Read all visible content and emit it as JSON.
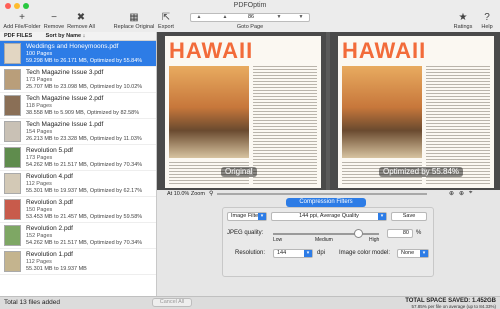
{
  "window": {
    "title": "PDFOptim",
    "traffic_colors": [
      "#ff5f57",
      "#febc2e",
      "#28c840"
    ]
  },
  "toolbar": {
    "add": "Add File/Folder",
    "remove": "Remove",
    "remove_all": "Remove All",
    "replace_original": "Replace Original",
    "export": "Export",
    "goto_page": "Goto Page",
    "page_value": "86",
    "ratings": "Ratings",
    "help": "Help"
  },
  "sidebar": {
    "header": "PDF FILES",
    "sort": "Sort by Name ↓",
    "items": [
      {
        "name": "Weddings and Honeymoons.pdf",
        "pages": "100 Pages",
        "stats": "59.298 MB to 26.171 MB, Optimized by 55.84%",
        "selected": true
      },
      {
        "name": "Tech Magazine Issue 3.pdf",
        "pages": "173 Pages",
        "stats": "25.707 MB to 23.098 MB, Optimized by 10.02%",
        "selected": false
      },
      {
        "name": "Tech Magazine Issue 2.pdf",
        "pages": "118 Pages",
        "stats": "38.558 MB to 5.909 MB, Optimized by 82.58%",
        "selected": false
      },
      {
        "name": "Tech Magazine Issue 1.pdf",
        "pages": "154 Pages",
        "stats": "26.213 MB to 23.328 MB, Optimized by 11.03%",
        "selected": false
      },
      {
        "name": "Revolution 5.pdf",
        "pages": "173 Pages",
        "stats": "54.262 MB to 21.517 MB, Optimized by 70.34%",
        "selected": false
      },
      {
        "name": "Revolution 4.pdf",
        "pages": "112 Pages",
        "stats": "55.301 MB to 19.937 MB, Optimized by 62.17%",
        "selected": false
      },
      {
        "name": "Revolution 3.pdf",
        "pages": "150 Pages",
        "stats": "53.453 MB to 21.457 MB, Optimized by 59.58%",
        "selected": false
      },
      {
        "name": "Revolution 2.pdf",
        "pages": "152 Pages",
        "stats": "54.262 MB to 21.517 MB, Optimized by 70.34%",
        "selected": false
      },
      {
        "name": "Revolution 1.pdf",
        "pages": "112 Pages",
        "stats": "55.301 MB to 19.937 MB",
        "selected": false
      }
    ]
  },
  "status": {
    "total": "Total 13 files added",
    "cancel": "Cancel All",
    "saved": "TOTAL SPACE SAVED: 1.452GB",
    "saved_sub": "57.85% per file on average (up to 84.33%)"
  },
  "preview": {
    "original_label": "Original",
    "optimized_label": "Optimized by 55.84%",
    "headline": "HAWAII",
    "zoom": "At 10.0% Zoom"
  },
  "compression": {
    "button": "Compression Filters",
    "filter_select": "Image Filter",
    "quality_select": "144 ppi, Average Quality",
    "save": "Save",
    "jpeg_label": "JPEG quality:",
    "jpeg_value": "80",
    "jpeg_unit": "%",
    "jpeg_fraction": 0.8,
    "low": "Low",
    "medium": "Medium",
    "high": "High",
    "resolution_label": "Resolution:",
    "resolution_value": "144",
    "resolution_unit": "dpi",
    "color_label": "Image color model:",
    "color_value": "None"
  }
}
